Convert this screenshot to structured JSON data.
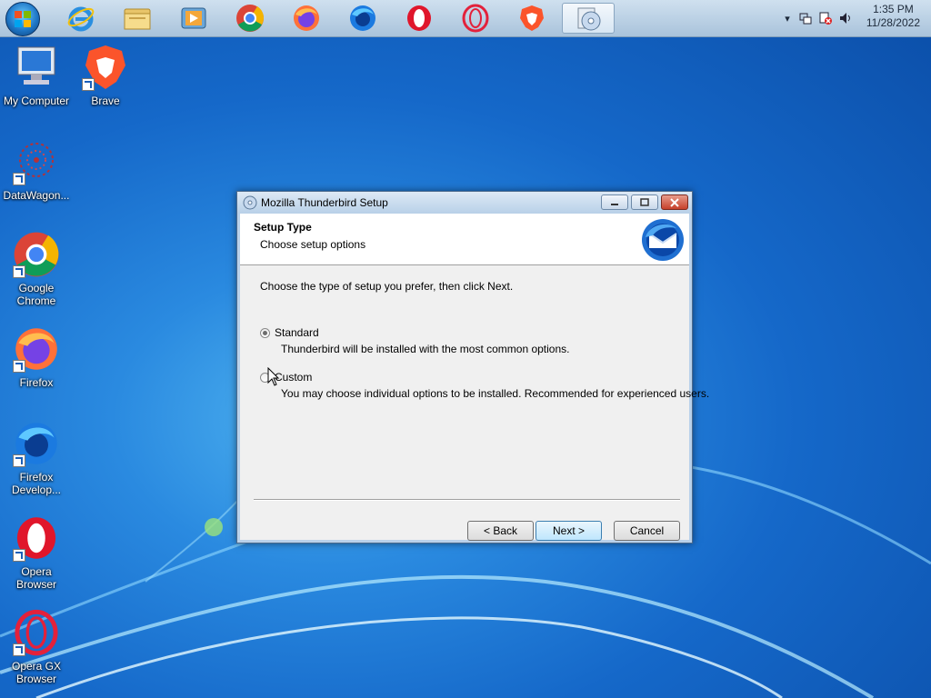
{
  "taskbar": {
    "pinned": [
      {
        "name": "Internet Explorer"
      },
      {
        "name": "Windows Explorer"
      },
      {
        "name": "Media Player"
      },
      {
        "name": "Google Chrome"
      },
      {
        "name": "Firefox"
      },
      {
        "name": "Firefox Developer"
      },
      {
        "name": "Opera"
      },
      {
        "name": "Opera GX"
      },
      {
        "name": "Brave"
      },
      {
        "name": "Setup"
      }
    ],
    "clock": {
      "time": "1:35 PM",
      "date": "11/28/2022"
    }
  },
  "desktop": {
    "icons": [
      {
        "label": "My Computer",
        "icon": "computer-icon"
      },
      {
        "label": "Brave",
        "icon": "brave-icon"
      },
      {
        "label": "DataWagon...",
        "icon": "datawagon-icon"
      },
      {
        "label": "Google Chrome",
        "icon": "chrome-icon"
      },
      {
        "label": "Firefox",
        "icon": "firefox-icon"
      },
      {
        "label": "Firefox Develop...",
        "icon": "firefox-developer-icon"
      },
      {
        "label": "Opera Browser",
        "icon": "opera-icon"
      },
      {
        "label": "Opera GX Browser",
        "icon": "opera-gx-icon"
      }
    ]
  },
  "window": {
    "title": "Mozilla Thunderbird Setup",
    "header_title": "Setup Type",
    "header_subtitle": "Choose setup options",
    "instruction": "Choose the type of setup you prefer, then click Next.",
    "options": [
      {
        "label": "Standard",
        "description": "Thunderbird will be installed with the most common options.",
        "selected": true
      },
      {
        "label": "Custom",
        "description": "You may choose individual options to be installed. Recommended for experienced users.",
        "selected": false
      }
    ],
    "buttons": {
      "back": "< Back",
      "next": "Next >",
      "cancel": "Cancel"
    }
  },
  "colors": {
    "accent": "#3c7fb1",
    "wallpaper": "#1568c9"
  }
}
